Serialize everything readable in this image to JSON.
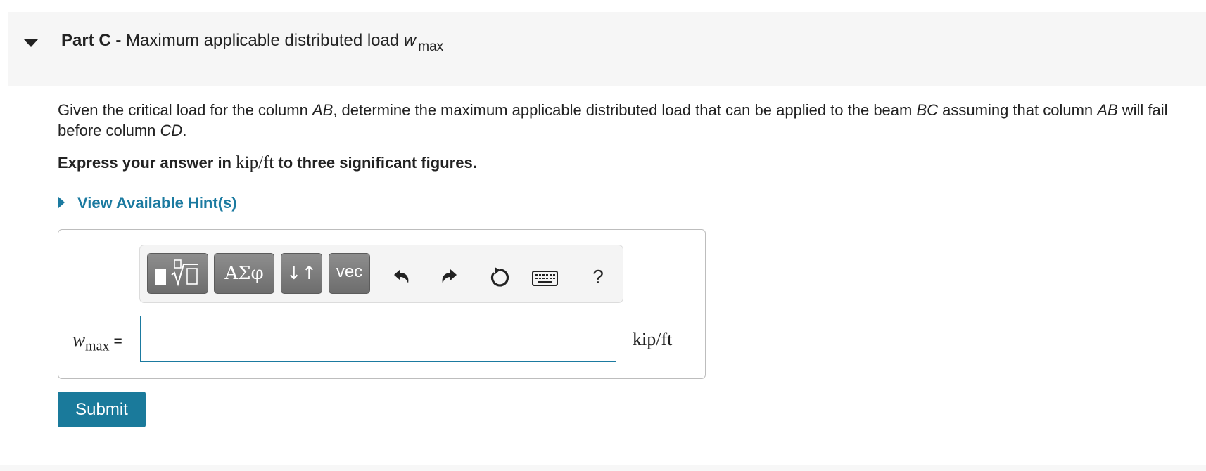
{
  "part": {
    "label": "Part C -",
    "title": "Maximum applicable distributed load",
    "var": "w",
    "sub": "max"
  },
  "question": {
    "t1": "Given the critical load for the column ",
    "v1": "AB",
    "t2": ", determine the maximum applicable distributed load that can be applied to the beam ",
    "v2": "BC",
    "t3": " assuming that column ",
    "v3": "AB",
    "t4": " will fail before column ",
    "v4": "CD",
    "t5": "."
  },
  "express": {
    "pre": "Express your answer in",
    "unit": "kip/ft",
    "post": "to three significant figures."
  },
  "hint_label": "View Available Hint(s)",
  "toolbar": {
    "greek_label": "ΑΣφ",
    "arrows_label": "↓↑",
    "vec_label": "vec",
    "help_label": "?",
    "icons": [
      "templates-icon",
      "greek-letters-icon",
      "subscript-superscript-icon",
      "vector-icon",
      "undo-icon",
      "redo-icon",
      "reset-icon",
      "keyboard-icon",
      "help-icon"
    ]
  },
  "answer": {
    "var": "w",
    "sub": "max",
    "eq": "=",
    "value": "",
    "unit": "kip/ft"
  },
  "submit_label": "Submit",
  "colors": {
    "accent": "#1b7aa0",
    "submit": "#1a7a9b",
    "header_bg": "#f6f6f6",
    "toolbar_button": "#7a7a7a"
  }
}
